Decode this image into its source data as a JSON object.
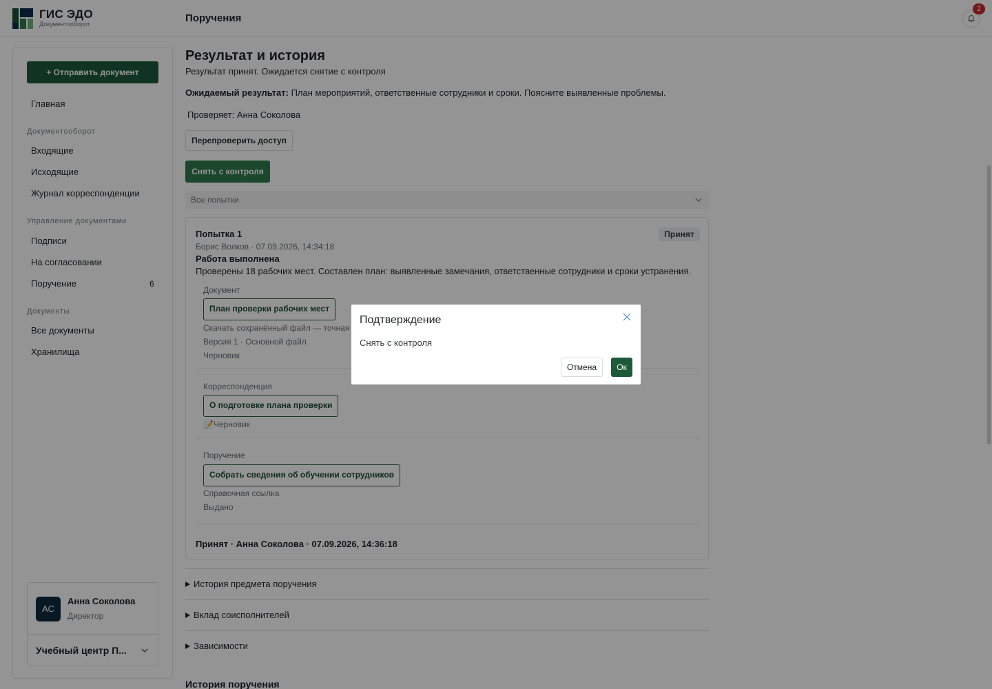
{
  "app": {
    "brand_title": "ГИС ЭДО",
    "brand_subtitle": "Документооборот",
    "page_title": "Поручения",
    "notifications_count": "2"
  },
  "sidebar": {
    "send_button": "+ Отправить документ",
    "home": "Главная",
    "section_docflow": "Документооборот",
    "incoming": "Входящие",
    "outgoing": "Исходящие",
    "correspondence_log": "Журнал корреспонденции",
    "section_management": "Управление документами",
    "signatures": "Подписи",
    "approvals": "На согласовании",
    "assignments": "Поручение",
    "assignments_count": "6",
    "section_documents": "Документы",
    "all_documents": "Все документы",
    "storage": "Хранилища",
    "user": {
      "initials": "АС",
      "name": "Анна Соколова",
      "role": "Директор",
      "org": "Учебный центр П..."
    }
  },
  "main": {
    "heading": "Результат и история",
    "status": "Результат принят. Ожидается снятие с контроля",
    "expected_label": "Ожидаемый результат:",
    "expected_text": " План мероприятий, ответственные сотрудники и сроки. Поясните выявленные проблемы.",
    "checker": "Проверяет: Анна Соколова",
    "recheck_button": "Перепроверить доступ",
    "remove_control_button": "Снять с контроля",
    "attempts_select": "Все попытки",
    "attempt": {
      "title": "Попытка 1",
      "badge": "Принят",
      "meta": "Борис Волков · 07.09.2026, 14:34:18",
      "result_title": "Работа выполнена",
      "result_text": "Проверены 18 рабочих мест. Составлен план: выявленные замечания, ответственные сотрудники и сроки устранения.",
      "document_label": "Документ",
      "document_link": "План проверки рабочих мест",
      "document_download": "Скачать сохранённый файл — точная",
      "document_version": "Версия 1 · Основной файл",
      "document_status": "Черновик",
      "correspondence_label": "Корреспонденция",
      "correspondence_link": "О подготовке плана проверки",
      "correspondence_status": "📝Черновик",
      "assignment_label": "Поручение",
      "assignment_link": "Собрать сведения об обучении сотрудников",
      "assignment_ref": "Справочная ссылка",
      "assignment_status": "Выдано",
      "footer": "Принят · Анна Соколова · 07.09.2026, 14:36:18"
    },
    "accordion": [
      "История предмета поручения",
      "Вклад соисполнителей",
      "Зависимости"
    ],
    "history_heading": "История поручения"
  },
  "modal": {
    "title": "Подтверждение",
    "body": "Снять с контроля",
    "cancel": "Отмена",
    "ok": "Ок"
  },
  "colors": {
    "primary": "#1d5a3a",
    "primary_light": "#2f7a4c",
    "badge_red": "#c62828"
  }
}
